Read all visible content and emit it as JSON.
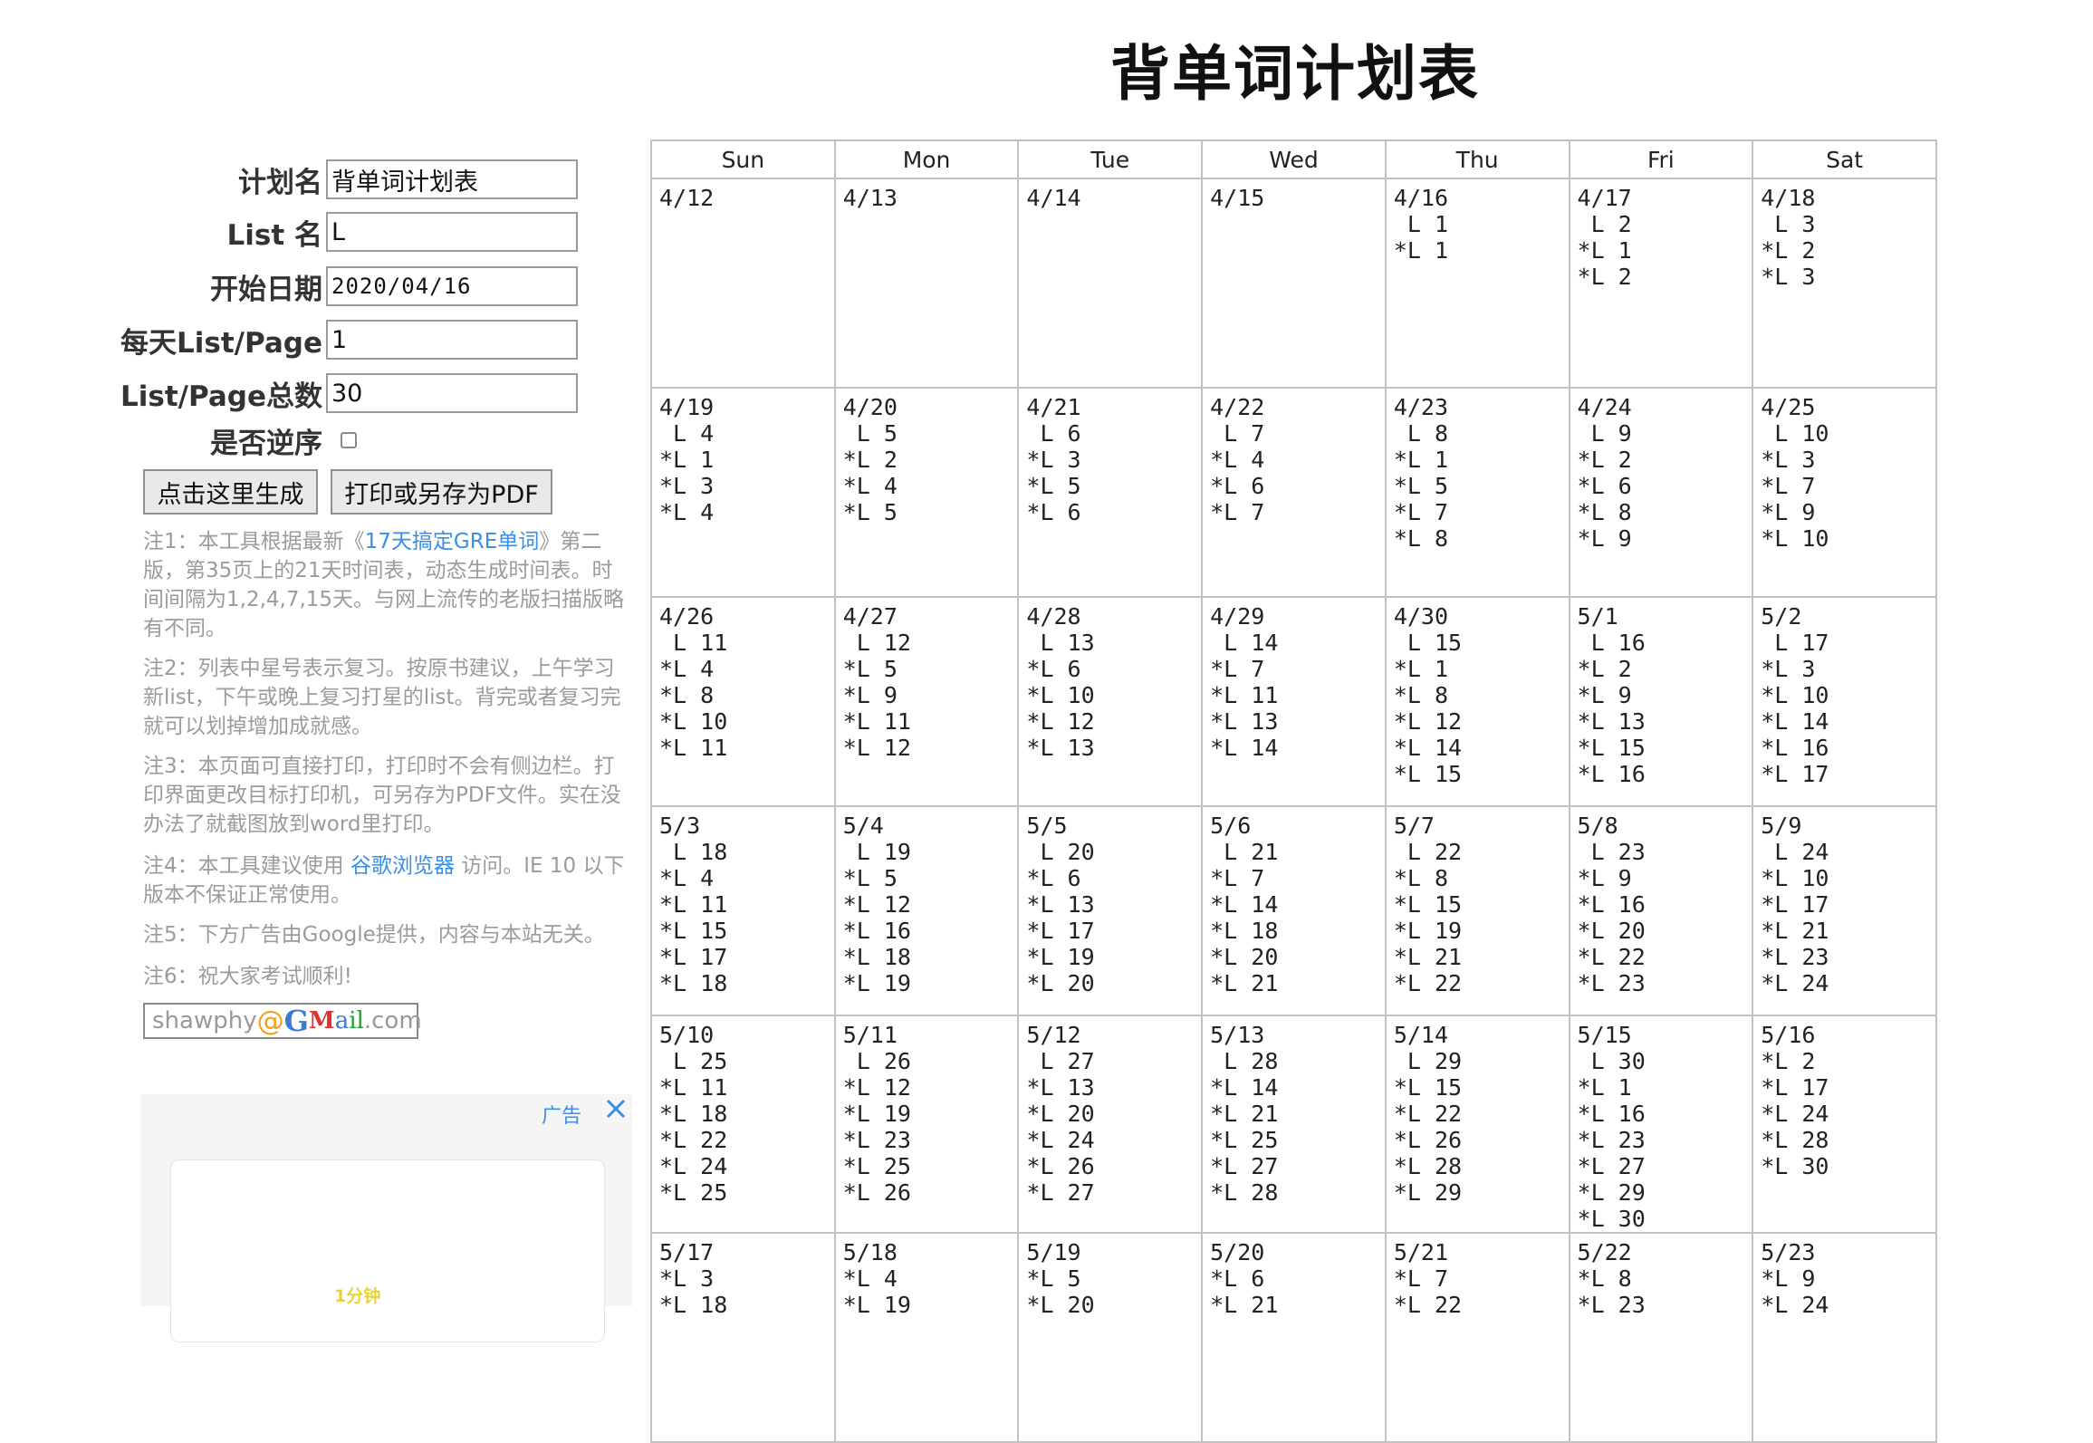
{
  "title": "背单词计划表",
  "form": {
    "plan_name_label": "计划名",
    "plan_name_value": "背单词计划表",
    "list_name_label": "List 名",
    "list_name_value": "L",
    "start_date_label": "开始日期",
    "start_date_value": "2020/04/16",
    "per_day_label": "每天List/Page",
    "per_day_value": "1",
    "total_label": "List/Page总数",
    "total_value": "30",
    "reverse_label": "是否逆序",
    "generate_button": "点击这里生成",
    "print_button": "打印或另存为PDF"
  },
  "notes": {
    "note1_a": "注1：本工具根据最新《",
    "note1_link": "17天搞定GRE单词",
    "note1_b": "》第二版，第35页上的21天时间表，动态生成时间表。时间间隔为1,2,4,7,15天。与网上流传的老版扫描版略有不同。",
    "note2": "注2：列表中星号表示复习。按原书建议，上午学习新list，下午或晚上复习打星的list。背完或者复习完就可以划掉增加成就感。",
    "note3": "注3：本页面可直接打印，打印时不会有侧边栏。打印界面更改目标打印机，可另存为PDF文件。实在没办法了就截图放到word里打印。",
    "note4_a": "注4：本工具建议使用 ",
    "note4_link": "谷歌浏览器",
    "note4_b": " 访问。IE 10 以下版本不保证正常使用。",
    "note5": "注5：下方广告由Google提供，内容与本站无关。",
    "note6": "注6：祝大家考试顺利!"
  },
  "email": {
    "user": "shawphy",
    "at": "@",
    "g1": "G",
    "g2": "M",
    "g3": "a",
    "g4": "il",
    "domain": ".com"
  },
  "ad": {
    "label": "广告",
    "text": "1分钟"
  },
  "calendar": {
    "days": [
      "Sun",
      "Mon",
      "Tue",
      "Wed",
      "Thu",
      "Fri",
      "Sat"
    ],
    "weeks": [
      [
        {
          "date": "4/12",
          "items": []
        },
        {
          "date": "4/13",
          "items": []
        },
        {
          "date": "4/14",
          "items": []
        },
        {
          "date": "4/15",
          "items": []
        },
        {
          "date": "4/16",
          "items": [
            " L 1",
            "*L 1"
          ]
        },
        {
          "date": "4/17",
          "items": [
            " L 2",
            "*L 1",
            "*L 2"
          ]
        },
        {
          "date": "4/18",
          "items": [
            " L 3",
            "*L 2",
            "*L 3"
          ]
        }
      ],
      [
        {
          "date": "4/19",
          "items": [
            " L 4",
            "*L 1",
            "*L 3",
            "*L 4"
          ]
        },
        {
          "date": "4/20",
          "items": [
            " L 5",
            "*L 2",
            "*L 4",
            "*L 5"
          ]
        },
        {
          "date": "4/21",
          "items": [
            " L 6",
            "*L 3",
            "*L 5",
            "*L 6"
          ]
        },
        {
          "date": "4/22",
          "items": [
            " L 7",
            "*L 4",
            "*L 6",
            "*L 7"
          ]
        },
        {
          "date": "4/23",
          "items": [
            " L 8",
            "*L 1",
            "*L 5",
            "*L 7",
            "*L 8"
          ]
        },
        {
          "date": "4/24",
          "items": [
            " L 9",
            "*L 2",
            "*L 6",
            "*L 8",
            "*L 9"
          ]
        },
        {
          "date": "4/25",
          "items": [
            " L 10",
            "*L 3",
            "*L 7",
            "*L 9",
            "*L 10"
          ]
        }
      ],
      [
        {
          "date": "4/26",
          "items": [
            " L 11",
            "*L 4",
            "*L 8",
            "*L 10",
            "*L 11"
          ]
        },
        {
          "date": "4/27",
          "items": [
            " L 12",
            "*L 5",
            "*L 9",
            "*L 11",
            "*L 12"
          ]
        },
        {
          "date": "4/28",
          "items": [
            " L 13",
            "*L 6",
            "*L 10",
            "*L 12",
            "*L 13"
          ]
        },
        {
          "date": "4/29",
          "items": [
            " L 14",
            "*L 7",
            "*L 11",
            "*L 13",
            "*L 14"
          ]
        },
        {
          "date": "4/30",
          "items": [
            " L 15",
            "*L 1",
            "*L 8",
            "*L 12",
            "*L 14",
            "*L 15"
          ]
        },
        {
          "date": "5/1",
          "items": [
            " L 16",
            "*L 2",
            "*L 9",
            "*L 13",
            "*L 15",
            "*L 16"
          ]
        },
        {
          "date": "5/2",
          "items": [
            " L 17",
            "*L 3",
            "*L 10",
            "*L 14",
            "*L 16",
            "*L 17"
          ]
        }
      ],
      [
        {
          "date": "5/3",
          "items": [
            " L 18",
            "*L 4",
            "*L 11",
            "*L 15",
            "*L 17",
            "*L 18"
          ]
        },
        {
          "date": "5/4",
          "items": [
            " L 19",
            "*L 5",
            "*L 12",
            "*L 16",
            "*L 18",
            "*L 19"
          ]
        },
        {
          "date": "5/5",
          "items": [
            " L 20",
            "*L 6",
            "*L 13",
            "*L 17",
            "*L 19",
            "*L 20"
          ]
        },
        {
          "date": "5/6",
          "items": [
            " L 21",
            "*L 7",
            "*L 14",
            "*L 18",
            "*L 20",
            "*L 21"
          ]
        },
        {
          "date": "5/7",
          "items": [
            " L 22",
            "*L 8",
            "*L 15",
            "*L 19",
            "*L 21",
            "*L 22"
          ]
        },
        {
          "date": "5/8",
          "items": [
            " L 23",
            "*L 9",
            "*L 16",
            "*L 20",
            "*L 22",
            "*L 23"
          ]
        },
        {
          "date": "5/9",
          "items": [
            " L 24",
            "*L 10",
            "*L 17",
            "*L 21",
            "*L 23",
            "*L 24"
          ]
        }
      ],
      [
        {
          "date": "5/10",
          "items": [
            " L 25",
            "*L 11",
            "*L 18",
            "*L 22",
            "*L 24",
            "*L 25"
          ]
        },
        {
          "date": "5/11",
          "items": [
            " L 26",
            "*L 12",
            "*L 19",
            "*L 23",
            "*L 25",
            "*L 26"
          ]
        },
        {
          "date": "5/12",
          "items": [
            " L 27",
            "*L 13",
            "*L 20",
            "*L 24",
            "*L 26",
            "*L 27"
          ]
        },
        {
          "date": "5/13",
          "items": [
            " L 28",
            "*L 14",
            "*L 21",
            "*L 25",
            "*L 27",
            "*L 28"
          ]
        },
        {
          "date": "5/14",
          "items": [
            " L 29",
            "*L 15",
            "*L 22",
            "*L 26",
            "*L 28",
            "*L 29"
          ]
        },
        {
          "date": "5/15",
          "items": [
            " L 30",
            "*L 1",
            "*L 16",
            "*L 23",
            "*L 27",
            "*L 29",
            "*L 30"
          ]
        },
        {
          "date": "5/16",
          "items": [
            "*L 2",
            "*L 17",
            "*L 24",
            "*L 28",
            "*L 30"
          ]
        }
      ],
      [
        {
          "date": "5/17",
          "items": [
            "*L 3",
            "*L 18"
          ]
        },
        {
          "date": "5/18",
          "items": [
            "*L 4",
            "*L 19"
          ]
        },
        {
          "date": "5/19",
          "items": [
            "*L 5",
            "*L 20"
          ]
        },
        {
          "date": "5/20",
          "items": [
            "*L 6",
            "*L 21"
          ]
        },
        {
          "date": "5/21",
          "items": [
            "*L 7",
            "*L 22"
          ]
        },
        {
          "date": "5/22",
          "items": [
            "*L 8",
            "*L 23"
          ]
        },
        {
          "date": "5/23",
          "items": [
            "*L 9",
            "*L 24"
          ]
        }
      ]
    ]
  }
}
